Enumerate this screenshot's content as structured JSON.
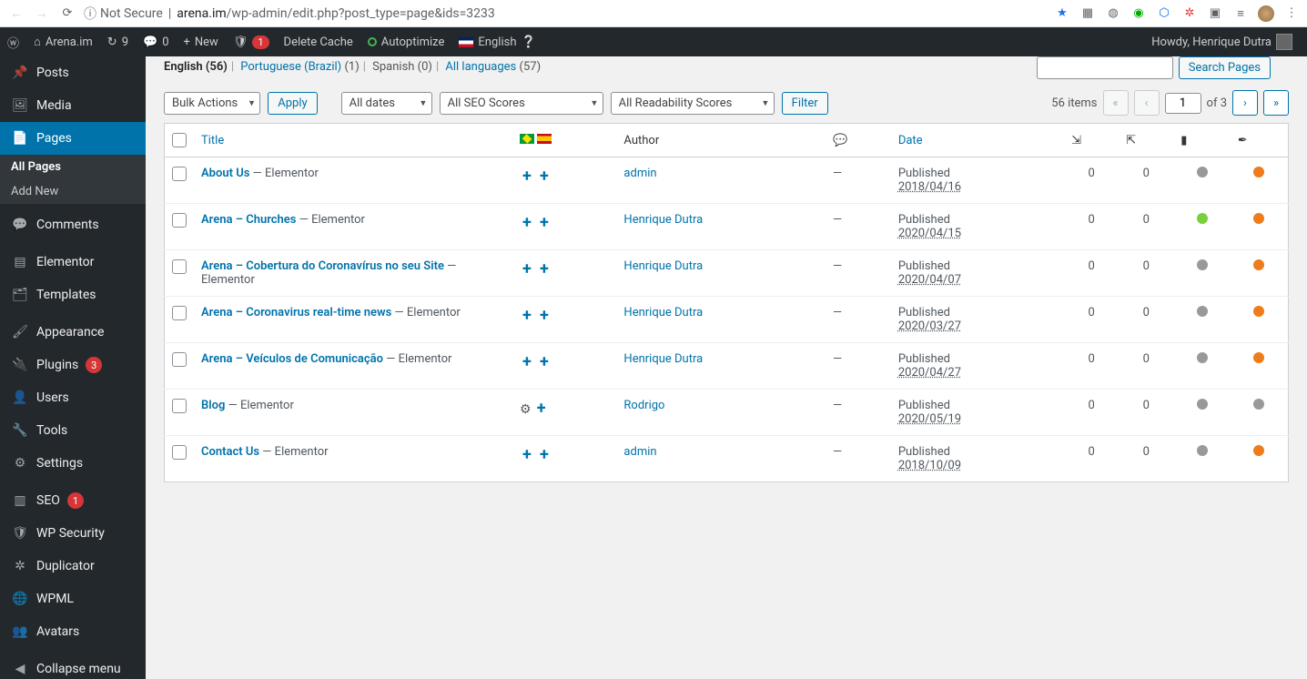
{
  "browser": {
    "not_secure": "Not Secure",
    "url_domain": "arena.im",
    "url_path": "/wp-admin/edit.php?post_type=page&ids=3233"
  },
  "adminbar": {
    "site_name": "Arena.im",
    "updates": "9",
    "comments": "0",
    "new": "New",
    "notif_count": "1",
    "delete_cache": "Delete Cache",
    "autoptimize": "Autoptimize",
    "english": "English",
    "howdy": "Howdy, Henrique Dutra"
  },
  "sidebar": {
    "posts": "Posts",
    "media": "Media",
    "pages": "Pages",
    "all_pages": "All Pages",
    "add_new": "Add New",
    "comments": "Comments",
    "elementor": "Elementor",
    "templates": "Templates",
    "appearance": "Appearance",
    "plugins": "Plugins",
    "plugins_count": "3",
    "users": "Users",
    "tools": "Tools",
    "settings": "Settings",
    "seo": "SEO",
    "seo_count": "1",
    "wp_security": "WP Security",
    "duplicator": "Duplicator",
    "wpml": "WPML",
    "avatars": "Avatars",
    "collapse": "Collapse menu"
  },
  "filters": {
    "lang_english": "English (56)",
    "lang_pt": "Portuguese (Brazil)",
    "lang_pt_count": "(1)",
    "lang_es": "Spanish (0)",
    "lang_all": "All languages",
    "lang_all_count": "(57)",
    "bulk_actions": "Bulk Actions",
    "apply": "Apply",
    "all_dates": "All dates",
    "seo_scores": "All SEO Scores",
    "readability": "All Readability Scores",
    "filter": "Filter",
    "search_pages": "Search Pages",
    "items_count": "56 items",
    "page_current": "1",
    "page_of": "of 3"
  },
  "columns": {
    "title": "Title",
    "author": "Author",
    "date": "Date"
  },
  "rows": [
    {
      "title": "About Us",
      "suffix": " — Elementor",
      "author": "admin",
      "comments": "—",
      "status": "Published",
      "date": "2018/04/16",
      "in": "0",
      "out": "0",
      "seo": "gray",
      "read": "orange",
      "trans": "plus-plus"
    },
    {
      "title": "Arena – Churches",
      "suffix": " — Elementor",
      "author": "Henrique Dutra",
      "comments": "—",
      "status": "Published",
      "date": "2020/04/15",
      "in": "0",
      "out": "0",
      "seo": "green",
      "read": "orange",
      "trans": "plus-plus"
    },
    {
      "title": "Arena – Cobertura do Coronavírus no seu Site",
      "suffix": " — Elementor",
      "author": "Henrique Dutra",
      "comments": "—",
      "status": "Published",
      "date": "2020/04/07",
      "in": "0",
      "out": "0",
      "seo": "gray",
      "read": "orange",
      "trans": "plus-plus"
    },
    {
      "title": "Arena – Coronavirus real-time news",
      "suffix": " — Elementor",
      "author": "Henrique Dutra",
      "comments": "—",
      "status": "Published",
      "date": "2020/03/27",
      "in": "0",
      "out": "0",
      "seo": "gray",
      "read": "orange",
      "trans": "plus-plus"
    },
    {
      "title": "Arena – Veículos de Comunicação",
      "suffix": " — Elementor",
      "author": "Henrique Dutra",
      "comments": "—",
      "status": "Published",
      "date": "2020/04/27",
      "in": "0",
      "out": "0",
      "seo": "gray",
      "read": "orange",
      "trans": "plus-plus"
    },
    {
      "title": "Blog",
      "suffix": " — Elementor",
      "author": "Rodrigo",
      "comments": "—",
      "status": "Published",
      "date": "2020/05/19",
      "in": "0",
      "out": "0",
      "seo": "gray",
      "read": "gray",
      "trans": "cog-plus"
    },
    {
      "title": "Contact Us",
      "suffix": " — Elementor",
      "author": "admin",
      "comments": "—",
      "status": "Published",
      "date": "2018/10/09",
      "in": "0",
      "out": "0",
      "seo": "gray",
      "read": "orange",
      "trans": "plus-plus"
    }
  ]
}
